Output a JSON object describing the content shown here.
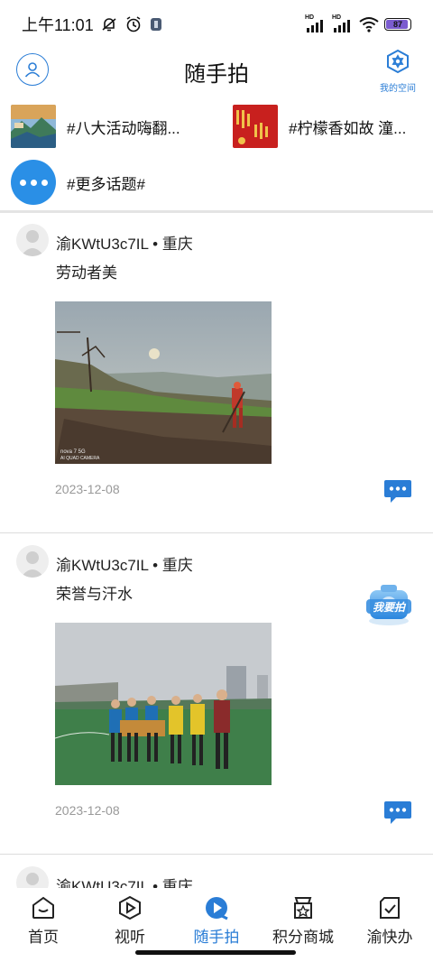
{
  "status_bar": {
    "time": "上午11:01",
    "battery": "87",
    "network_badge": "HD"
  },
  "header": {
    "title": "随手拍",
    "space_label": "我的空间"
  },
  "topics": [
    {
      "label": "#八大活动嗨翻..."
    },
    {
      "label": "#柠檬香如故 潼..."
    },
    {
      "label": "#更多话题#"
    }
  ],
  "posts": [
    {
      "user": "渝KWtU3c7IL • 重庆",
      "text": "劳动者美",
      "date": "2023-12-08"
    },
    {
      "user": "渝KWtU3c7IL • 重庆",
      "text": "荣誉与汗水",
      "date": "2023-12-08"
    },
    {
      "user": "渝KWtU3c7IL • 重庆"
    }
  ],
  "fab": {
    "label": "我要拍"
  },
  "photo_overlay": {
    "caption": "nova 7 5G\nAI QUAD CAMERA"
  },
  "bottom_nav": [
    {
      "label": "首页",
      "icon": "home-icon"
    },
    {
      "label": "视听",
      "icon": "play-icon"
    },
    {
      "label": "随手拍",
      "icon": "camera-play-icon",
      "active": true
    },
    {
      "label": "积分商城",
      "icon": "shop-bag-icon"
    },
    {
      "label": "渝快办",
      "icon": "check-clipboard-icon"
    }
  ],
  "colors": {
    "accent": "#2a7dd6",
    "topic_circle": "#2a8fe6"
  }
}
